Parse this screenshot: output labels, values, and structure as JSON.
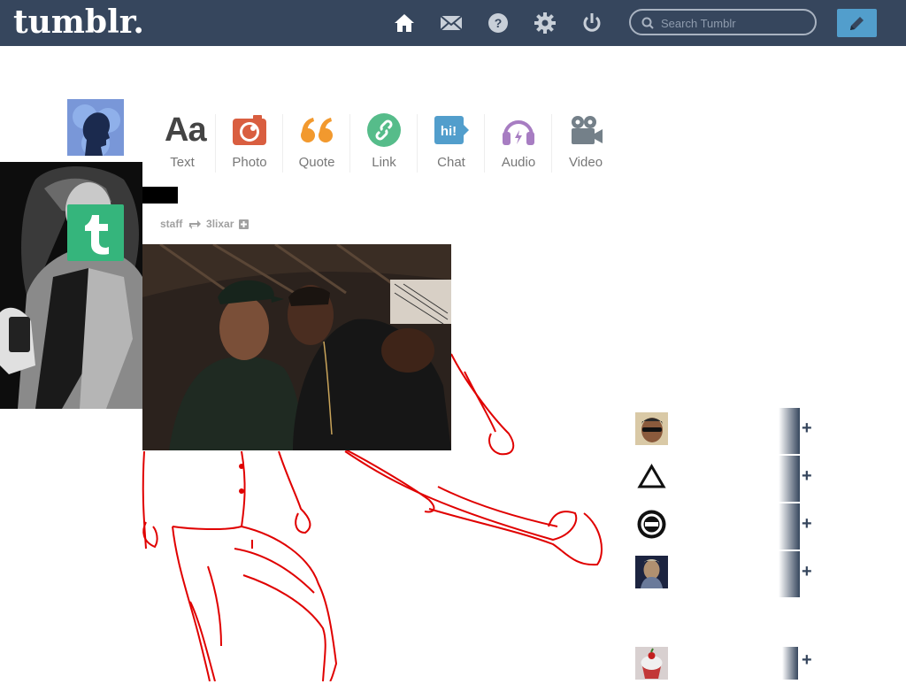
{
  "header": {
    "logo": "tumblr.",
    "search_placeholder": "Search Tumblr",
    "nav": [
      "home-icon",
      "mail-icon",
      "help-icon",
      "gear-icon",
      "power-icon"
    ],
    "compose_icon": "pencil-icon",
    "colors": {
      "bar": "#36465d",
      "compose": "#529ecc"
    }
  },
  "post_types": [
    {
      "label": "Text",
      "icon": "text-icon",
      "color": "#444444"
    },
    {
      "label": "Photo",
      "icon": "camera-icon",
      "color": "#d95e40"
    },
    {
      "label": "Quote",
      "icon": "quote-icon",
      "color": "#f2992e"
    },
    {
      "label": "Link",
      "icon": "link-icon",
      "color": "#56bc8a"
    },
    {
      "label": "Chat",
      "icon": "chat-icon",
      "color": "#529ecc"
    },
    {
      "label": "Audio",
      "icon": "headphones-icon",
      "color": "#a77dc2"
    },
    {
      "label": "Video",
      "icon": "video-camera-icon",
      "color": "#748089"
    }
  ],
  "post": {
    "user": "staff",
    "reblogged_from": "3lixar"
  },
  "recommended": [
    {
      "name": "avatar-sunglasses"
    },
    {
      "name": "avatar-triangle"
    },
    {
      "name": "avatar-seal"
    },
    {
      "name": "avatar-portrait"
    },
    {
      "name": "avatar-cupcake"
    }
  ]
}
